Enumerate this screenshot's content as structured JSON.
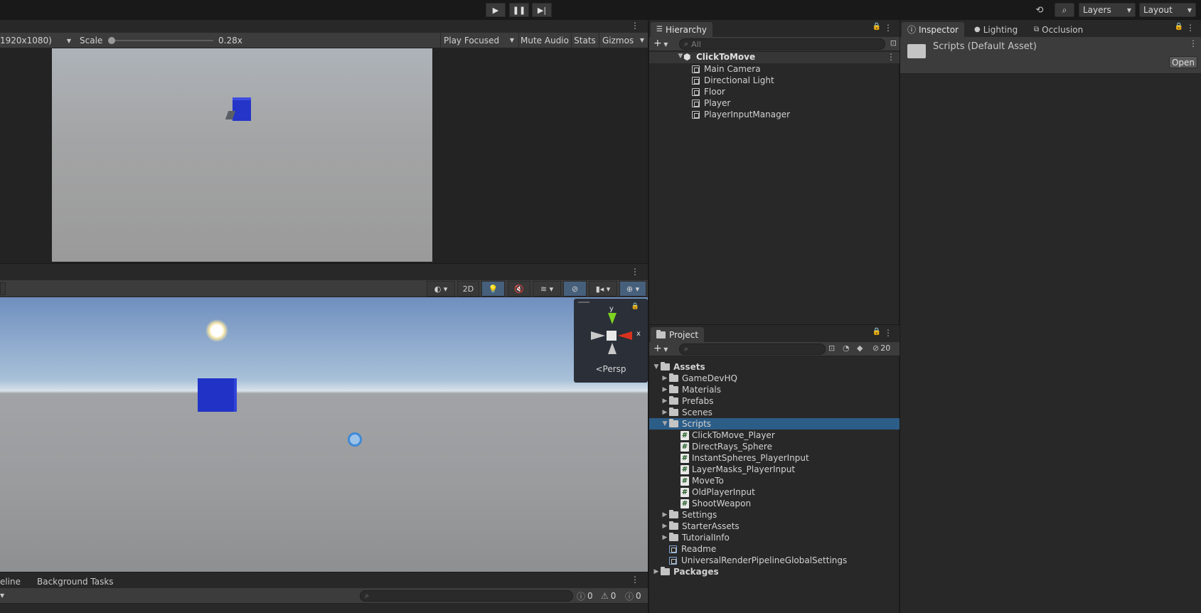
{
  "top": {
    "play_icon": "play-icon",
    "pause_icon": "pause-icon",
    "step_icon": "step-icon",
    "layers_label": "Layers",
    "layout_label": "Layout"
  },
  "game_view": {
    "resolution": "1920x1080)",
    "scale_label": "Scale",
    "scale_value": "0.28x",
    "scale_fraction": 0.0,
    "play_focused": "Play Focused",
    "mute_audio": "Mute Audio",
    "stats": "Stats",
    "gizmos": "Gizmos"
  },
  "scene_view": {
    "mode_2d": "2D",
    "gizmo_y": "y",
    "gizmo_x": "x",
    "persp_label": "Persp"
  },
  "console_bar": {
    "tab_timeline": "eline",
    "tab_background": "Background Tasks",
    "count_info": "0",
    "count_warn": "0",
    "count_error": "0"
  },
  "hierarchy": {
    "tab_label": "Hierarchy",
    "search_placeholder": "All",
    "scene_name": "ClickToMove",
    "items": [
      {
        "label": "Main Camera"
      },
      {
        "label": "Directional Light"
      },
      {
        "label": "Floor"
      },
      {
        "label": "Player"
      },
      {
        "label": "PlayerInputManager"
      }
    ]
  },
  "project": {
    "tab_label": "Project",
    "hidden_count": "20",
    "assets_label": "Assets",
    "folders_top": [
      {
        "label": "GameDevHQ"
      },
      {
        "label": "Materials"
      },
      {
        "label": "Prefabs"
      },
      {
        "label": "Scenes"
      }
    ],
    "scripts_folder": "Scripts",
    "scripts": [
      {
        "label": "ClickToMove_Player"
      },
      {
        "label": "DirectRays_Sphere"
      },
      {
        "label": "InstantSpheres_PlayerInput"
      },
      {
        "label": "LayerMasks_PlayerInput"
      },
      {
        "label": "MoveTo"
      },
      {
        "label": "OldPlayerInput"
      },
      {
        "label": "ShootWeapon"
      }
    ],
    "folders_bottom": [
      {
        "label": "Settings"
      },
      {
        "label": "StarterAssets"
      },
      {
        "label": "TutorialInfo"
      }
    ],
    "files": [
      {
        "label": "Readme"
      },
      {
        "label": "UniversalRenderPipelineGlobalSettings"
      }
    ],
    "packages_label": "Packages"
  },
  "inspector": {
    "tab_inspector": "Inspector",
    "tab_lighting": "Lighting",
    "tab_occlusion": "Occlusion",
    "asset_title": "Scripts (Default Asset)",
    "open_button": "Open"
  },
  "colors": {
    "accent_selection": "#2c5d87",
    "cube_blue": "#1c2ec8",
    "sky_top": "#6f8fbf"
  }
}
